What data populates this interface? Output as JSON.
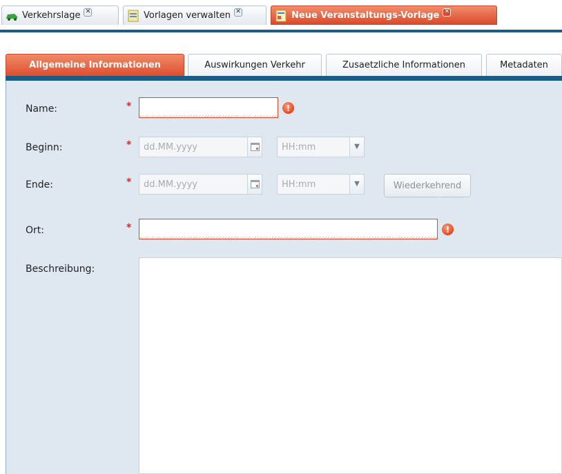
{
  "doc_tabs": [
    {
      "label": "Verkehrslage",
      "icon": "car-icon",
      "closable": true
    },
    {
      "label": "Vorlagen verwalten",
      "icon": "document-icon",
      "closable": true
    },
    {
      "label": "Neue Veranstaltungs-Vorlage",
      "icon": "calendar-document-icon",
      "closable": true,
      "active": true
    }
  ],
  "form_tabs": [
    {
      "label": "Allgemeine Informationen",
      "active": true
    },
    {
      "label": "Auswirkungen Verkehr"
    },
    {
      "label": "Zusaetzliche Informationen"
    },
    {
      "label": "Metadaten"
    }
  ],
  "form": {
    "required_marker": "*",
    "error_symbol": "!",
    "name": {
      "label": "Name:",
      "value": ""
    },
    "beginn": {
      "label": "Beginn:",
      "date_placeholder": "dd.MM.yyyy",
      "time_placeholder": "HH:mm"
    },
    "ende": {
      "label": "Ende:",
      "date_placeholder": "dd.MM.yyyy",
      "time_placeholder": "HH:mm",
      "recurring_button": "Wiederkehrend"
    },
    "ort": {
      "label": "Ort:",
      "value": ""
    },
    "beschreibung": {
      "label": "Beschreibung:",
      "value": ""
    }
  },
  "colors": {
    "accent": "#dd4e2e",
    "strip": "#1b5c86",
    "panel": "#dfe8f1",
    "required": "#e0261d"
  }
}
